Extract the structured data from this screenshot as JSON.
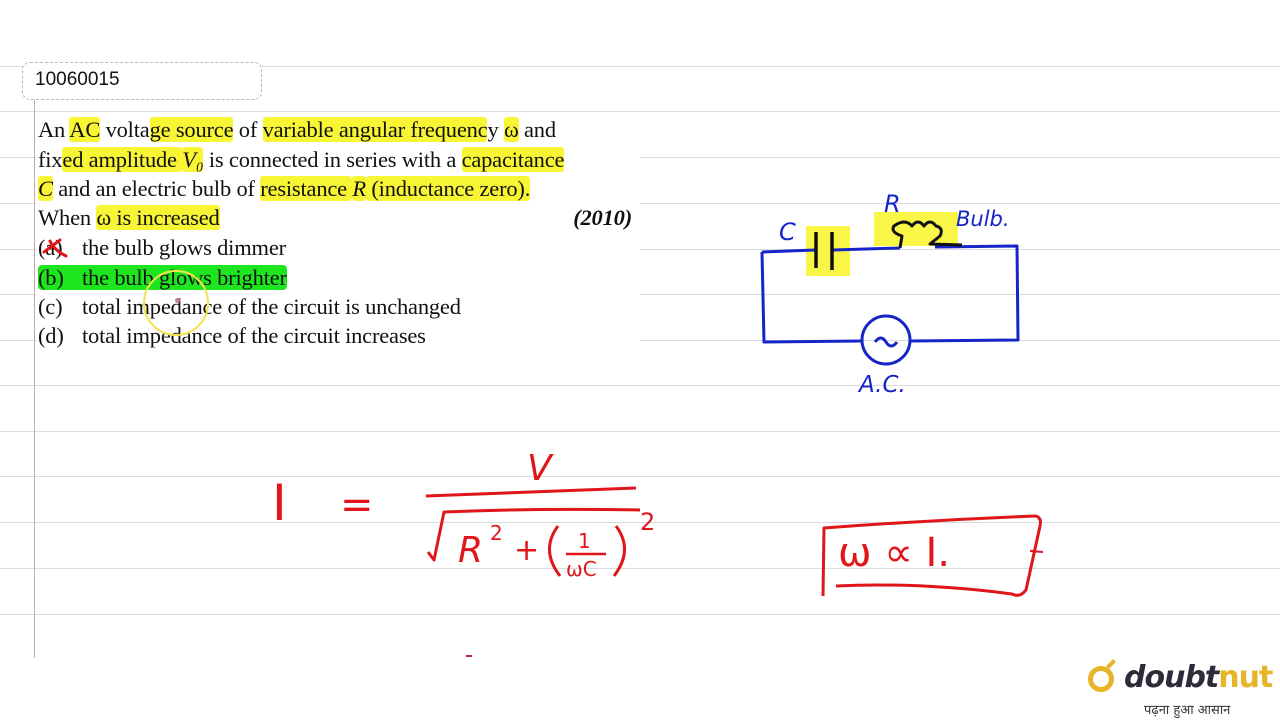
{
  "question_id": "10060015",
  "question": {
    "lines": [
      {
        "segments": [
          {
            "text": "An ",
            "style": "plain"
          },
          {
            "text": "AC",
            "style": "highlight"
          },
          {
            "text": " volta",
            "style": "plain"
          },
          {
            "text": "ge source",
            "style": "highlight"
          },
          {
            "text": " of ",
            "style": "plain"
          },
          {
            "text": "variable angular frequenc",
            "style": "highlight"
          },
          {
            "text": "y ",
            "style": "plain"
          },
          {
            "text": "ω",
            "style": "highlight"
          },
          {
            "text": " and",
            "style": "plain"
          }
        ]
      },
      {
        "segments": [
          {
            "text": "fix",
            "style": "plain"
          },
          {
            "text": "ed amplitude ",
            "style": "highlight"
          },
          {
            "text": "V₀",
            "style": "highlight-italic"
          },
          {
            "text": " is connected in series with a ",
            "style": "plain"
          },
          {
            "text": "capacitance",
            "style": "highlight"
          }
        ]
      },
      {
        "segments": [
          {
            "text": "C",
            "style": "highlight-italic"
          },
          {
            "text": " and an electric bulb of ",
            "style": "plain"
          },
          {
            "text": "resistance ",
            "style": "highlight"
          },
          {
            "text": "R",
            "style": "highlight-italic"
          },
          {
            "text": " (inductance zero).",
            "style": "highlight"
          }
        ]
      },
      {
        "segments": [
          {
            "text": "When ",
            "style": "plain"
          },
          {
            "text": "ω is increased",
            "style": "highlight"
          }
        ],
        "year": "(2010)"
      }
    ],
    "options": [
      {
        "label": "(a)",
        "text": "the bulb glows dimmer",
        "marked": "crossed-out"
      },
      {
        "label": "(b)",
        "text": "the bulb glows brighter",
        "marked": "correct-highlight"
      },
      {
        "label": "(c)",
        "text": "total impedance of the circuit is unchanged",
        "marked": "none"
      },
      {
        "label": "(d)",
        "text": "total impedance of the circuit increases",
        "marked": "none"
      }
    ]
  },
  "annotations": {
    "circuit": {
      "capacitor_label": "C",
      "resistor_label": "R",
      "bulb_label": "Bulb.",
      "source_label": "A.C.",
      "source_symbol": "~"
    },
    "formula": {
      "lhs": "I",
      "equals": "=",
      "numerator": "V",
      "denominator": "√(R² + (1/ωC)²)",
      "denominator_parts": {
        "r_term": "R",
        "r_exp": "2",
        "plus": "+",
        "frac_num": "1",
        "frac_den": "ωC",
        "outer_exp": "2"
      }
    },
    "conclusion": "ω ∝ I."
  },
  "colors": {
    "highlight_yellow": "#f8f534",
    "highlight_green": "#1ee61e",
    "ink_blue": "#1525c8",
    "ink_red": "#e0161a",
    "brand_gold": "#e8b428",
    "brand_dark": "#2c2c3a"
  },
  "branding": {
    "logo_part1": "doubt",
    "logo_part2": "nut",
    "tagline": "पढ़ना हुआ आसान"
  }
}
